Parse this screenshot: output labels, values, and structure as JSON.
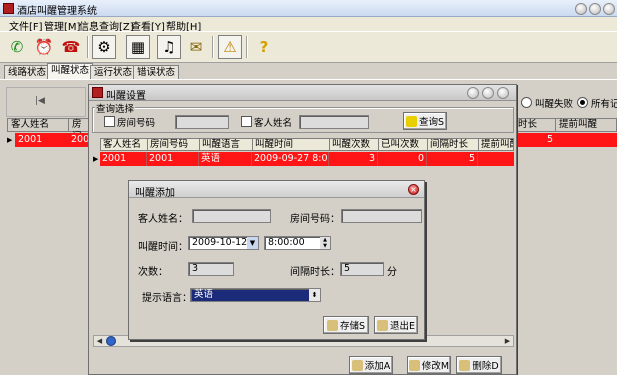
{
  "window": {
    "title": "酒店叫醒管理系统"
  },
  "menu": [
    "文件[F]",
    "管理[M]",
    "信息查询[Z]",
    "查看[Y]",
    "帮助[H]"
  ],
  "toolbar_icons": [
    "phone-green-icon",
    "alarm-icon",
    "hangup-icon",
    "tools-icon",
    "grid-icon",
    "notes-icon",
    "mail-icon",
    "warning-icon",
    "help-icon"
  ],
  "tabs": [
    "线路状态",
    "叫醒状态",
    "运行状态",
    "错误状态"
  ],
  "background": {
    "headers": [
      "客人姓名",
      "房间",
      "时长",
      "提前叫醒"
    ],
    "row": {
      "name": "2001",
      "room": "200",
      "duration": "5"
    },
    "radio_labels": [
      "叫醒失败",
      "所有记录"
    ]
  },
  "wake_settings": {
    "title": "叫醒设置",
    "query_group": "查询选择",
    "room_check_label": "房间号码",
    "guest_check_label": "客人姓名",
    "query_button": "查询S",
    "columns": [
      "客人姓名",
      "房间号码",
      "叫醒语言",
      "叫醒时间",
      "叫醒次数",
      "已叫次数",
      "间隔时长",
      "提前叫醒"
    ],
    "row": [
      "2001",
      "2001",
      "英语",
      "2009-09-27 8:00:00",
      "3",
      "0",
      "5",
      ""
    ],
    "add_button": "添加A",
    "edit_button": "修改M",
    "delete_button": "删除D"
  },
  "wake_add": {
    "title": "叫醒添加",
    "guest_label": "客人姓名：",
    "room_label": "房间号码：",
    "time_label": "叫醒时间：",
    "date_value": "2009-10-12",
    "time_value": "8:00:00",
    "count_label": "次数：",
    "count_value": "3",
    "interval_label": "间隔时长：",
    "interval_value": "5",
    "interval_unit": "分",
    "language_label": "提示语言：",
    "language_value": "英语",
    "save_button": "存储S",
    "exit_button": "退出E"
  }
}
